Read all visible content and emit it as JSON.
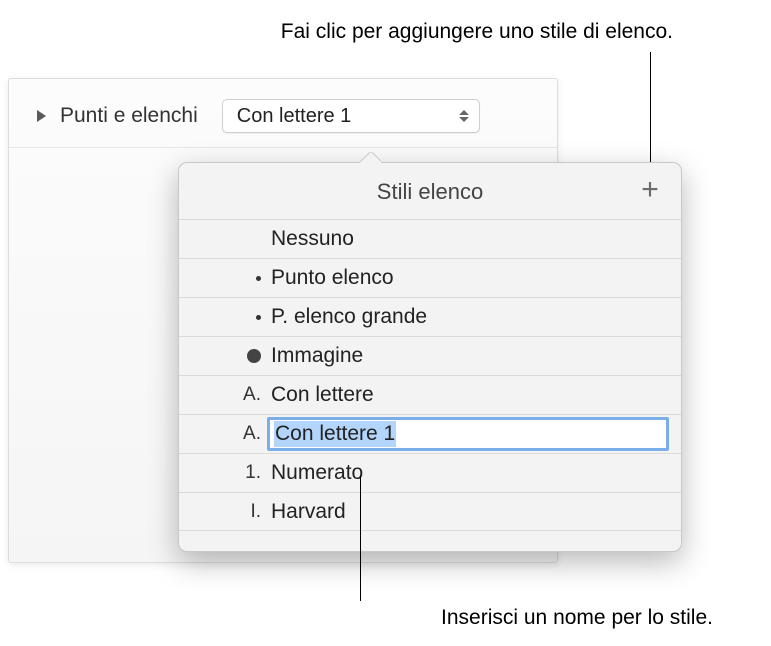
{
  "callouts": {
    "top": "Fai clic per aggiungere uno stile di elenco.",
    "bottom": "Inserisci un nome per lo stile."
  },
  "panel": {
    "header_label": "Punti e elenchi",
    "dropdown_value": "Con lettere 1"
  },
  "popover": {
    "title": "Stili elenco",
    "add_icon": "+",
    "items": [
      {
        "marker_type": "none",
        "marker": "",
        "label": "Nessuno"
      },
      {
        "marker_type": "dot",
        "marker": "",
        "label": "Punto elenco"
      },
      {
        "marker_type": "dot",
        "marker": "",
        "label": "P. elenco grande"
      },
      {
        "marker_type": "bigdot",
        "marker": "",
        "label": "Immagine"
      },
      {
        "marker_type": "text",
        "marker": "A.",
        "label": "Con lettere"
      },
      {
        "marker_type": "text",
        "marker": "A.",
        "label": "Con lettere 1",
        "editing": true
      },
      {
        "marker_type": "text",
        "marker": "1.",
        "label": "Numerato"
      },
      {
        "marker_type": "text",
        "marker": "I.",
        "label": "Harvard"
      }
    ]
  }
}
